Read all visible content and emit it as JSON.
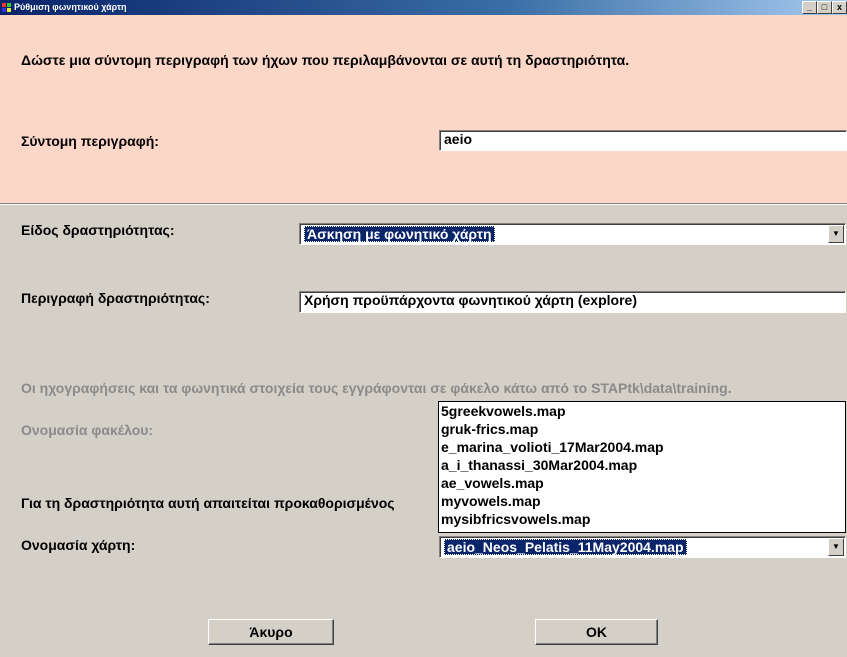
{
  "window": {
    "title": "Ρύθμιση φωνητικού χάρτη",
    "controls": [
      "_",
      "□",
      "x"
    ]
  },
  "intro": "Δώστε μια σύντομη περιγραφή των ήχων που περιλαμβάνονται σε αυτή τη δραστηριότητα.",
  "short_desc": {
    "label": "Σύντομη περιγραφή:",
    "value": "aeio"
  },
  "activity_type": {
    "label": "Είδος δραστηριότητας:",
    "value": "Άσκηση με φωνητικό χάρτη"
  },
  "activity_desc": {
    "label": "Περιγραφή δραστηριότητας:",
    "value": "Χρήση προϋπάρχοντα φωνητικού χάρτη (explore)"
  },
  "recordings_note": "Οι ηχογραφήσεις και τα φωνητικά στοιχεία τους εγγράφονται σε φάκελο κάτω από το STAPtk\\data\\training.",
  "folder_label": "Ονομασία φακέλου:",
  "requirement_note": "Για τη δραστηριότητα αυτή απαιτείται προκαθορισμένος",
  "map": {
    "label": "Ονομασία χάρτη:",
    "value": "aeio_Neos_Pelatis_11May2004.map",
    "options": [
      "5greekvowels.map",
      "gruk-frics.map",
      "e_marina_volioti_17Mar2004.map",
      "a_i_thanassi_30Mar2004.map",
      "ae_vowels.map",
      "myvowels.map",
      "mysibfricsvowels.map"
    ]
  },
  "buttons": {
    "cancel": "Άκυρο",
    "ok": "OK"
  }
}
